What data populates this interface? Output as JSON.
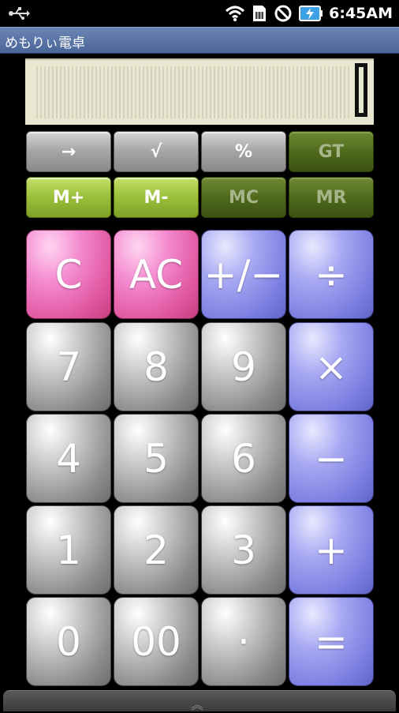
{
  "status_bar": {
    "time": "6:45AM",
    "icons": [
      "usb-icon",
      "wifi-icon",
      "sim-icon",
      "no-signal-icon",
      "battery-charging-icon"
    ]
  },
  "app": {
    "title": "めもりぃ電卓"
  },
  "display": {
    "value": "0"
  },
  "function_keys": {
    "row1": [
      {
        "label": "→",
        "name": "backspace-key",
        "style": "gray"
      },
      {
        "label": "√",
        "name": "sqrt-key",
        "style": "gray"
      },
      {
        "label": "%",
        "name": "percent-key",
        "style": "gray"
      },
      {
        "label": "GT",
        "name": "gt-key",
        "style": "dark-green"
      }
    ],
    "row2": [
      {
        "label": "M+",
        "name": "m-plus-key",
        "style": "light-green"
      },
      {
        "label": "M-",
        "name": "m-minus-key",
        "style": "light-green"
      },
      {
        "label": "MC",
        "name": "mc-key",
        "style": "dark-green"
      },
      {
        "label": "MR",
        "name": "mr-key",
        "style": "dark-green"
      }
    ]
  },
  "keys": {
    "row1": [
      {
        "label": "C",
        "name": "clear-key",
        "style": "pink"
      },
      {
        "label": "AC",
        "name": "all-clear-key",
        "style": "pink"
      },
      {
        "label": "+/−",
        "name": "sign-toggle-key",
        "style": "blue"
      },
      {
        "label": "÷",
        "name": "divide-key",
        "style": "blue"
      }
    ],
    "row2": [
      {
        "label": "7",
        "name": "digit-7-key",
        "style": "gray"
      },
      {
        "label": "8",
        "name": "digit-8-key",
        "style": "gray"
      },
      {
        "label": "9",
        "name": "digit-9-key",
        "style": "gray"
      },
      {
        "label": "×",
        "name": "multiply-key",
        "style": "blue"
      }
    ],
    "row3": [
      {
        "label": "4",
        "name": "digit-4-key",
        "style": "gray"
      },
      {
        "label": "5",
        "name": "digit-5-key",
        "style": "gray"
      },
      {
        "label": "6",
        "name": "digit-6-key",
        "style": "gray"
      },
      {
        "label": "−",
        "name": "subtract-key",
        "style": "blue"
      }
    ],
    "row4": [
      {
        "label": "1",
        "name": "digit-1-key",
        "style": "gray"
      },
      {
        "label": "2",
        "name": "digit-2-key",
        "style": "gray"
      },
      {
        "label": "3",
        "name": "digit-3-key",
        "style": "gray"
      },
      {
        "label": "+",
        "name": "add-key",
        "style": "blue"
      }
    ],
    "row5": [
      {
        "label": "0",
        "name": "digit-0-key",
        "style": "gray"
      },
      {
        "label": "00",
        "name": "double-zero-key",
        "style": "gray"
      },
      {
        "label": "·",
        "name": "decimal-key",
        "style": "gray"
      },
      {
        "label": "=",
        "name": "equals-key",
        "style": "blue"
      }
    ]
  },
  "colors": {
    "title_bar": "#5a74a8",
    "display_bg": "#e8e8d0",
    "pink_key": "#e0559f",
    "blue_key": "#7a7de0",
    "gray_key": "#8a8a8a",
    "light_green_key": "#9ec23e",
    "dark_green_key": "#4f6a1c"
  },
  "drawer": {
    "icon": "chevron-up-icon"
  }
}
